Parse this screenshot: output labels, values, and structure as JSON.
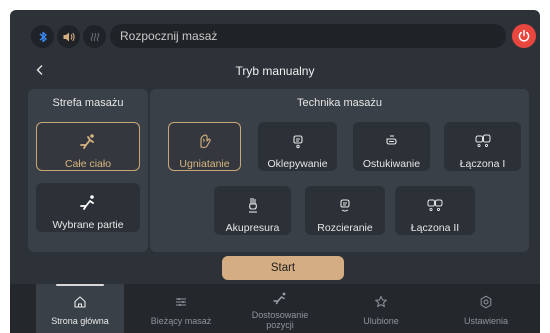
{
  "top_bar": {
    "bluetooth_icon": "bluetooth-icon",
    "volume_icon": "volume-icon",
    "heat_icon": "heat-icon",
    "status_text": "Rozpocznij masaż",
    "power_color": "#e9473e"
  },
  "header": {
    "title": "Tryb manualny"
  },
  "zone_panel": {
    "title": "Strefa masażu",
    "options": [
      {
        "label": "Całe ciało",
        "selected": true
      },
      {
        "label": "Wybrane partie",
        "selected": false
      }
    ]
  },
  "technique_panel": {
    "title": "Technika masażu",
    "options": [
      {
        "label": "Ugniatanie",
        "selected": true
      },
      {
        "label": "Oklepywanie",
        "selected": false
      },
      {
        "label": "Ostukiwanie",
        "selected": false
      },
      {
        "label": "Łączona I",
        "selected": false
      },
      {
        "label": "Akupresura",
        "selected": false
      },
      {
        "label": "Rozcieranie",
        "selected": false
      },
      {
        "label": "Łączona II",
        "selected": false
      }
    ]
  },
  "start_button": {
    "label": "Start",
    "color": "#d5ad82"
  },
  "bottom_nav": {
    "items": [
      {
        "label": "Strona główna",
        "icon": "home-icon",
        "active": true
      },
      {
        "label": "Bieżący masaż",
        "icon": "sliders-icon",
        "active": false
      },
      {
        "label": "Dostosowanie pozycji",
        "icon": "recline-icon",
        "active": false
      },
      {
        "label": "Ulubione",
        "icon": "star-icon",
        "active": false
      },
      {
        "label": "Ustawienia",
        "icon": "gear-icon",
        "active": false
      }
    ]
  },
  "colors": {
    "accent": "#c8a679",
    "background": "#2d3238",
    "panel": "#3a4048"
  }
}
